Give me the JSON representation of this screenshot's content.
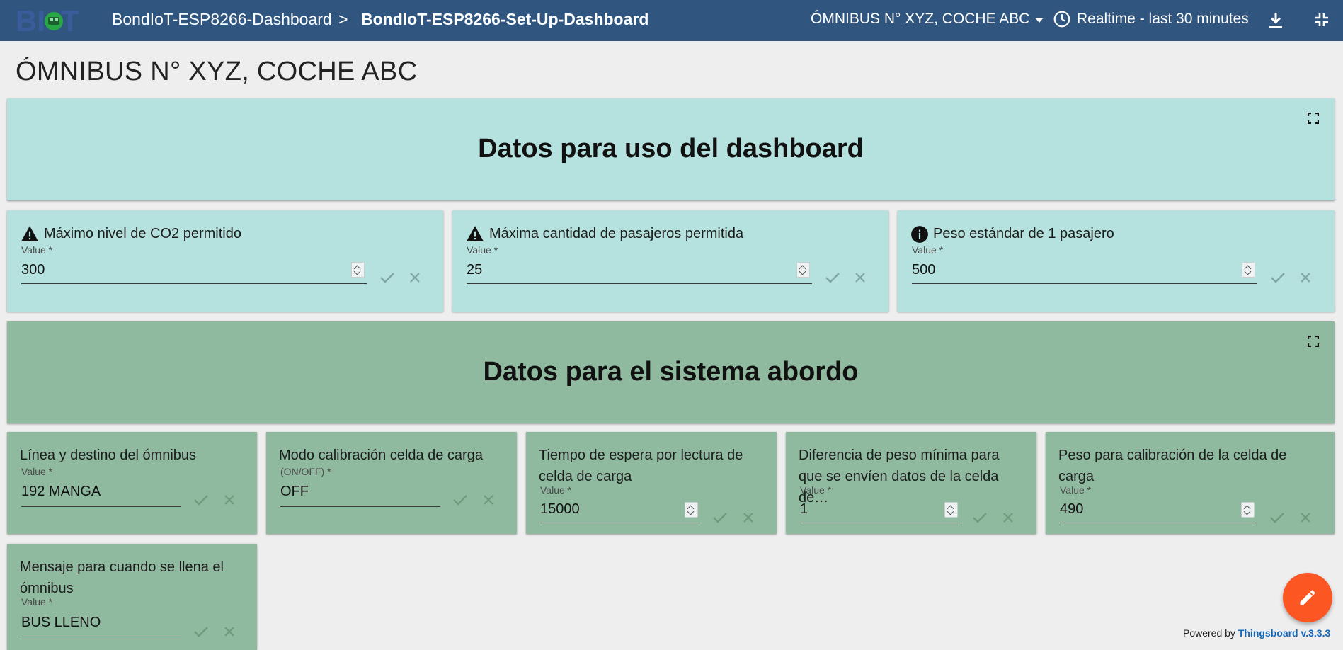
{
  "header": {
    "logo_text": "BIoT",
    "breadcrumb": [
      "BondIoT-ESP8266-Dashboard",
      "BondIoT-ESP8266-Set-Up-Dashboard"
    ],
    "breadcrumb_separator": ">",
    "entity_selector": "ÓMNIBUS N° XYZ, COCHE ABC",
    "timewindow": "Realtime - last 30 minutes",
    "icons": [
      "clock-icon",
      "download-icon",
      "exit-fullscreen-icon"
    ]
  },
  "dashboard_title": "ÓMNIBUS N° XYZ, COCHE ABC",
  "sections": [
    {
      "title": "Datos para uso del dashboard",
      "color": "#b5e1de"
    },
    {
      "title": "Datos para el sistema abordo",
      "color": "#8fba9f"
    }
  ],
  "widgets_dashboard": [
    {
      "title": "Máximo nivel de CO2 permitido",
      "icon": "warning-icon",
      "label": "Value *",
      "value": "300"
    },
    {
      "title": "Máxima cantidad de pasajeros permitida",
      "icon": "warning-icon",
      "label": "Value *",
      "value": "25"
    },
    {
      "title": "Peso estándar de 1 pasajero",
      "icon": "info-icon",
      "label": "Value *",
      "value": "500"
    }
  ],
  "widgets_system": [
    {
      "title": "Línea y destino del ómnibus",
      "label": "Value *",
      "value": "192 MANGA"
    },
    {
      "title": "Modo calibración celda de carga",
      "label": "(ON/OFF) *",
      "value": "OFF"
    },
    {
      "title": "Tiempo de espera por lectura de celda de carga",
      "label": "Value *",
      "value": "15000"
    },
    {
      "title": "Diferencia de peso mínima para que se envíen datos de la celda de…",
      "label": "Value *",
      "value": "1"
    },
    {
      "title": "Peso para calibración de la celda de carga",
      "label": "Value *",
      "value": "490"
    },
    {
      "title": "Mensaje para cuando se llena el ómnibus",
      "label": "Value *",
      "value": "BUS LLENO"
    }
  ],
  "footer": {
    "powered_by": "Powered by",
    "brand": "Thingsboard v.3.3.3"
  },
  "colors": {
    "header": "#305680",
    "accent_fab": "#fc5722",
    "link": "#1767b8"
  }
}
